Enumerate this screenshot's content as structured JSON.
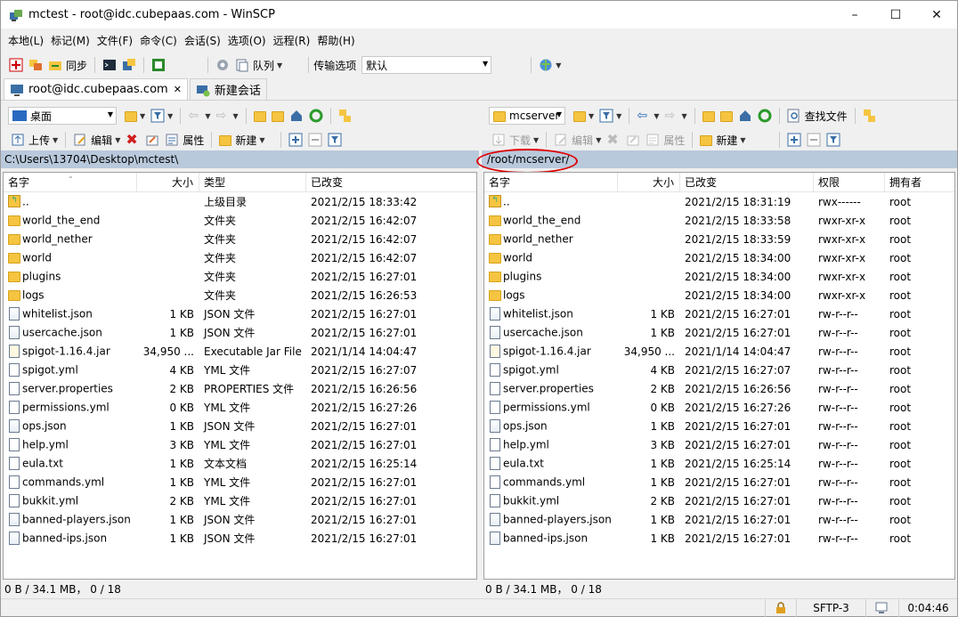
{
  "window": {
    "title": "mctest - root@idc.cubepaas.com - WinSCP"
  },
  "menu": [
    "本地(L)",
    "标记(M)",
    "文件(F)",
    "命令(C)",
    "会话(S)",
    "选项(O)",
    "远程(R)",
    "帮助(H)"
  ],
  "toolbar": {
    "sync_label": "同步",
    "queue_label": "队列",
    "transfer_options_label": "传输选项",
    "transfer_preset": "默认"
  },
  "tabs": [
    {
      "label": "root@idc.cubepaas.com"
    },
    {
      "label": "新建会话"
    }
  ],
  "left": {
    "location": "桌面",
    "upload_label": "上传",
    "edit_label": "编辑",
    "properties_label": "属性",
    "new_label": "新建",
    "path": "C:\\Users\\13704\\Desktop\\mctest\\",
    "columns": [
      "名字",
      "大小",
      "类型",
      "已改变"
    ],
    "rows": [
      {
        "name": "..",
        "size": "",
        "type": "上级目录",
        "mod": "2021/2/15   18:33:42",
        "icon": "updir"
      },
      {
        "name": "world_the_end",
        "size": "",
        "type": "文件夹",
        "mod": "2021/2/15   16:42:07",
        "icon": "folder"
      },
      {
        "name": "world_nether",
        "size": "",
        "type": "文件夹",
        "mod": "2021/2/15   16:42:07",
        "icon": "folder"
      },
      {
        "name": "world",
        "size": "",
        "type": "文件夹",
        "mod": "2021/2/15   16:42:07",
        "icon": "folder"
      },
      {
        "name": "plugins",
        "size": "",
        "type": "文件夹",
        "mod": "2021/2/15   16:27:01",
        "icon": "folder"
      },
      {
        "name": "logs",
        "size": "",
        "type": "文件夹",
        "mod": "2021/2/15   16:26:53",
        "icon": "folder"
      },
      {
        "name": "whitelist.json",
        "size": "1 KB",
        "type": "JSON 文件",
        "mod": "2021/2/15   16:27:01",
        "icon": "json"
      },
      {
        "name": "usercache.json",
        "size": "1 KB",
        "type": "JSON 文件",
        "mod": "2021/2/15   16:27:01",
        "icon": "json"
      },
      {
        "name": "spigot-1.16.4.jar",
        "size": "34,950 ...",
        "type": "Executable Jar File",
        "mod": "2021/1/14   14:04:47",
        "icon": "jar"
      },
      {
        "name": "spigot.yml",
        "size": "4 KB",
        "type": "YML 文件",
        "mod": "2021/2/15   16:27:07",
        "icon": "doc"
      },
      {
        "name": "server.properties",
        "size": "2 KB",
        "type": "PROPERTIES 文件",
        "mod": "2021/2/15   16:26:56",
        "icon": "doc"
      },
      {
        "name": "permissions.yml",
        "size": "0 KB",
        "type": "YML 文件",
        "mod": "2021/2/15   16:27:26",
        "icon": "doc"
      },
      {
        "name": "ops.json",
        "size": "1 KB",
        "type": "JSON 文件",
        "mod": "2021/2/15   16:27:01",
        "icon": "json"
      },
      {
        "name": "help.yml",
        "size": "3 KB",
        "type": "YML 文件",
        "mod": "2021/2/15   16:27:01",
        "icon": "doc"
      },
      {
        "name": "eula.txt",
        "size": "1 KB",
        "type": "文本文档",
        "mod": "2021/2/15   16:25:14",
        "icon": "doc"
      },
      {
        "name": "commands.yml",
        "size": "1 KB",
        "type": "YML 文件",
        "mod": "2021/2/15   16:27:01",
        "icon": "doc"
      },
      {
        "name": "bukkit.yml",
        "size": "2 KB",
        "type": "YML 文件",
        "mod": "2021/2/15   16:27:01",
        "icon": "doc"
      },
      {
        "name": "banned-players.json",
        "size": "1 KB",
        "type": "JSON 文件",
        "mod": "2021/2/15   16:27:01",
        "icon": "json"
      },
      {
        "name": "banned-ips.json",
        "size": "1 KB",
        "type": "JSON 文件",
        "mod": "2021/2/15   16:27:01",
        "icon": "json"
      }
    ],
    "status": "0 B / 34.1 MB，  0 / 18"
  },
  "right": {
    "location": "mcserver",
    "download_label": "下载",
    "edit_label": "编辑",
    "properties_label": "属性",
    "new_label": "新建",
    "find_label": "查找文件",
    "path": "/root/mcserver/",
    "columns": [
      "名字",
      "大小",
      "已改变",
      "权限",
      "拥有者"
    ],
    "rows": [
      {
        "name": "..",
        "size": "",
        "mod": "2021/2/15   18:31:19",
        "perm": "rwx------",
        "owner": "root",
        "icon": "updir"
      },
      {
        "name": "world_the_end",
        "size": "",
        "mod": "2021/2/15   18:33:58",
        "perm": "rwxr-xr-x",
        "owner": "root",
        "icon": "folder"
      },
      {
        "name": "world_nether",
        "size": "",
        "mod": "2021/2/15   18:33:59",
        "perm": "rwxr-xr-x",
        "owner": "root",
        "icon": "folder"
      },
      {
        "name": "world",
        "size": "",
        "mod": "2021/2/15   18:34:00",
        "perm": "rwxr-xr-x",
        "owner": "root",
        "icon": "folder"
      },
      {
        "name": "plugins",
        "size": "",
        "mod": "2021/2/15   18:34:00",
        "perm": "rwxr-xr-x",
        "owner": "root",
        "icon": "folder"
      },
      {
        "name": "logs",
        "size": "",
        "mod": "2021/2/15   18:34:00",
        "perm": "rwxr-xr-x",
        "owner": "root",
        "icon": "folder"
      },
      {
        "name": "whitelist.json",
        "size": "1 KB",
        "mod": "2021/2/15   16:27:01",
        "perm": "rw-r--r--",
        "owner": "root",
        "icon": "json"
      },
      {
        "name": "usercache.json",
        "size": "1 KB",
        "mod": "2021/2/15   16:27:01",
        "perm": "rw-r--r--",
        "owner": "root",
        "icon": "json"
      },
      {
        "name": "spigot-1.16.4.jar",
        "size": "34,950 ...",
        "mod": "2021/1/14   14:04:47",
        "perm": "rw-r--r--",
        "owner": "root",
        "icon": "jar"
      },
      {
        "name": "spigot.yml",
        "size": "4 KB",
        "mod": "2021/2/15   16:27:07",
        "perm": "rw-r--r--",
        "owner": "root",
        "icon": "doc"
      },
      {
        "name": "server.properties",
        "size": "2 KB",
        "mod": "2021/2/15   16:26:56",
        "perm": "rw-r--r--",
        "owner": "root",
        "icon": "doc"
      },
      {
        "name": "permissions.yml",
        "size": "0 KB",
        "mod": "2021/2/15   16:27:26",
        "perm": "rw-r--r--",
        "owner": "root",
        "icon": "doc"
      },
      {
        "name": "ops.json",
        "size": "1 KB",
        "mod": "2021/2/15   16:27:01",
        "perm": "rw-r--r--",
        "owner": "root",
        "icon": "json"
      },
      {
        "name": "help.yml",
        "size": "3 KB",
        "mod": "2021/2/15   16:27:01",
        "perm": "rw-r--r--",
        "owner": "root",
        "icon": "doc"
      },
      {
        "name": "eula.txt",
        "size": "1 KB",
        "mod": "2021/2/15   16:25:14",
        "perm": "rw-r--r--",
        "owner": "root",
        "icon": "doc"
      },
      {
        "name": "commands.yml",
        "size": "1 KB",
        "mod": "2021/2/15   16:27:01",
        "perm": "rw-r--r--",
        "owner": "root",
        "icon": "doc"
      },
      {
        "name": "bukkit.yml",
        "size": "2 KB",
        "mod": "2021/2/15   16:27:01",
        "perm": "rw-r--r--",
        "owner": "root",
        "icon": "doc"
      },
      {
        "name": "banned-players.json",
        "size": "1 KB",
        "mod": "2021/2/15   16:27:01",
        "perm": "rw-r--r--",
        "owner": "root",
        "icon": "json"
      },
      {
        "name": "banned-ips.json",
        "size": "1 KB",
        "mod": "2021/2/15   16:27:01",
        "perm": "rw-r--r--",
        "owner": "root",
        "icon": "json"
      }
    ],
    "status": "0 B / 34.1 MB，  0 / 18"
  },
  "bottom": {
    "protocol": "SFTP-3",
    "elapsed": "0:04:46"
  },
  "colors": {
    "path_bar": "#b9c9dc",
    "annotation": "#e00000",
    "folder": "#f5c542"
  }
}
